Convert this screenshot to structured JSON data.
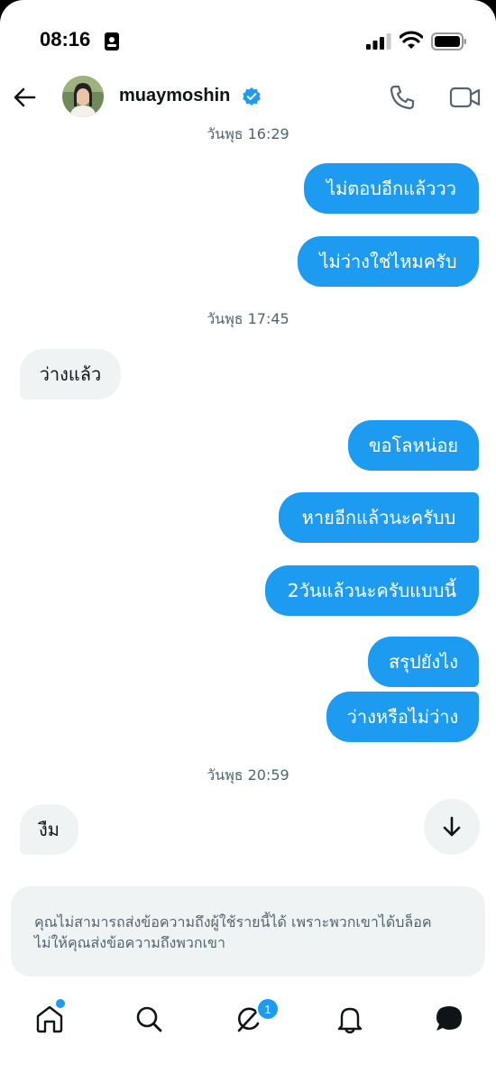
{
  "status_bar": {
    "time": "08:16"
  },
  "header": {
    "username": "muaymoshin"
  },
  "messages": {
    "ts1": "วันพุธ 16:29",
    "m1": "ไม่ตอบอีกแล้ววว",
    "m2": "ไม่ว่างใช่ไหมครับ",
    "ts2": "วันพุธ 17:45",
    "m3": "ว่างแล้ว",
    "m4": "ขอโลหน่อย",
    "m5": "หายอีกแล้วนะครับบ",
    "m6": "2วันแล้วนะครับแบบนี้",
    "m7": "สรุปยังไง",
    "m8": "ว่างหรือไม่ว่าง",
    "ts3": "วันพุธ 20:59",
    "m9": "งืม"
  },
  "notice": {
    "line1": "คุณไม่สามารถส่งข้อความถึงผู้ใช้รายนี้ได้ เพราะพวกเขาได้บล็อค",
    "line2": "ไม่ให้คุณส่งข้อความถึงพวกเขา"
  },
  "nav": {
    "messages_badge": "1"
  },
  "colors": {
    "accent": "#1d9bf0",
    "incoming_bg": "#eff3f4",
    "muted_text": "#536471"
  },
  "icons": [
    "id-card-icon",
    "signal-icon",
    "wifi-icon",
    "battery-icon",
    "back-arrow-icon",
    "verified-icon",
    "phone-icon",
    "video-icon",
    "arrow-down-icon",
    "home-icon",
    "search-icon",
    "grok-icon",
    "bell-icon",
    "messages-icon"
  ]
}
